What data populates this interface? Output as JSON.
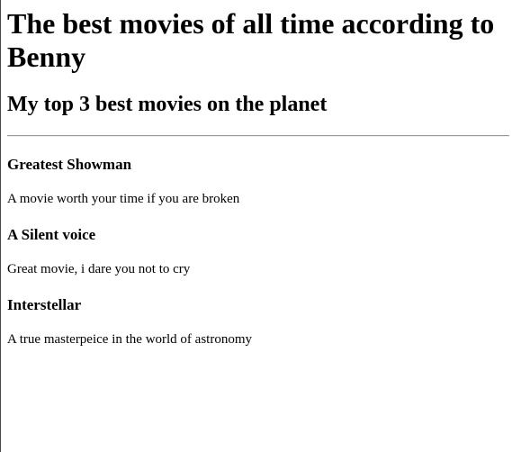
{
  "page": {
    "title": "The best movies of all time according to Benny",
    "subtitle": "My top 3 best movies on the planet"
  },
  "movies": [
    {
      "title": "Greatest Showman",
      "description": "A movie worth your time if you are broken"
    },
    {
      "title": "A Silent voice",
      "description": "Great movie, i dare you not to cry"
    },
    {
      "title": "Interstellar",
      "description": "A true masterpeice in the world of astronomy"
    }
  ]
}
